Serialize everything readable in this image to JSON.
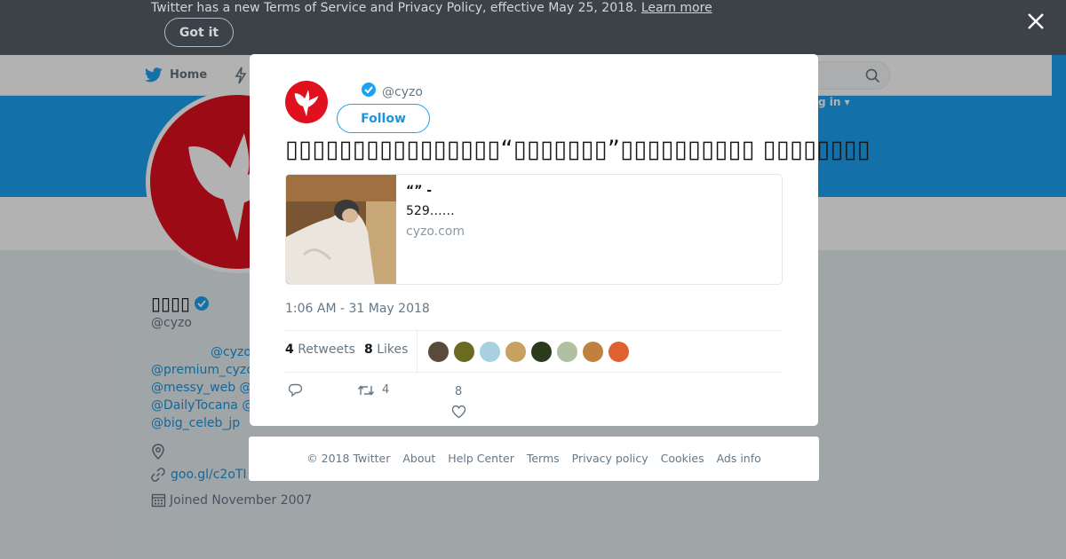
{
  "notice": {
    "text": "Twitter has a new Terms of Service and Privacy Policy, effective May 25, 2018.",
    "link": "Learn more",
    "button": "Got it"
  },
  "nav": {
    "home": "Home",
    "login_fragment": "g in ▾"
  },
  "profile": {
    "name": "▯▯▯▯",
    "handle": "@cyzo",
    "bio_lines": [
      "@cyzo",
      "@premium_cyzo",
      "@messy_web @",
      "@DailyTocana @",
      "@big_celeb_jp"
    ],
    "url": "goo.gl/c2oTI",
    "joined": "Joined November 2007"
  },
  "tweet": {
    "handle": "@cyzo",
    "follow_label": "Follow",
    "text": "▯▯▯▯▯▯▯▯▯▯▯▯▯▯▯▯“▯▯▯▯▯▯▯”▯▯▯▯▯▯▯▯▯▯ ▯▯▯▯▯▯▯▯",
    "card": {
      "title": "“” -",
      "description": "529……",
      "domain": "cyzo.com"
    },
    "timestamp": "1:06 AM - 31 May 2018",
    "retweets": {
      "count": "4",
      "label": "Retweets"
    },
    "likes": {
      "count": "8",
      "label": "Likes"
    },
    "action_retweet_count": "4",
    "action_like_count": "8",
    "liker_colors": [
      "#5a4a3a",
      "#6b6b1f",
      "#a8d0e0",
      "#c8a060",
      "#2a3a1a",
      "#b0c0a0",
      "#c08040",
      "#e06030"
    ]
  },
  "footer": {
    "links": [
      "© 2018 Twitter",
      "About",
      "Help Center",
      "Terms",
      "Privacy policy",
      "Cookies",
      "Ads info"
    ]
  },
  "colors": {
    "accent": "#1da1f2",
    "brand_red": "#e0111f"
  }
}
